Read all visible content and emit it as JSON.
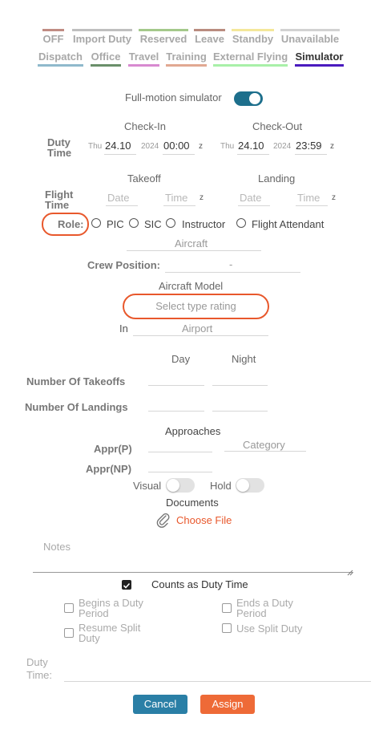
{
  "tabs_row1": [
    {
      "label": "OFF",
      "color": "#c08c83"
    },
    {
      "label": "Import Duty",
      "color": "#bfbfbf"
    },
    {
      "label": "Reserved",
      "color": "#a4c98b"
    },
    {
      "label": "Leave",
      "color": "#b98c7f"
    },
    {
      "label": "Standby",
      "color": "#f4e79a"
    },
    {
      "label": "Unavailable",
      "color": "#d2d2d2"
    }
  ],
  "tabs_row2": [
    {
      "label": "Dispatch",
      "color": "#8fb9cc"
    },
    {
      "label": "Office",
      "color": "#6a8f6a"
    },
    {
      "label": "Travel",
      "color": "#d88ad0"
    },
    {
      "label": "Training",
      "color": "#e1a892"
    },
    {
      "label": "External Flying",
      "color": "#a8f0a8"
    },
    {
      "label": "Simulator",
      "color": "#4a1bbf",
      "active": true
    }
  ],
  "simulator_toggle": {
    "label": "Full-motion simulator",
    "on": true,
    "color": "#1d6f8c"
  },
  "duty_time": {
    "label_line1": "Duty",
    "label_line2": "Time",
    "check_in": {
      "header": "Check-In",
      "day": "Thu",
      "date": "24.10",
      "year": "2024",
      "time": "00:00",
      "tz": "z"
    },
    "check_out": {
      "header": "Check-Out",
      "day": "Thu",
      "date": "24.10",
      "year": "2024",
      "time": "23:59",
      "tz": "z"
    }
  },
  "flight_time": {
    "label_line1": "Flight",
    "label_line2": "Time",
    "takeoff": {
      "header": "Takeoff",
      "date_placeholder": "Date",
      "time_placeholder": "Time",
      "tz": "z"
    },
    "landing": {
      "header": "Landing",
      "date_placeholder": "Date",
      "time_placeholder": "Time",
      "tz": "z"
    }
  },
  "role": {
    "label": "Role:",
    "options": [
      "PIC",
      "SIC",
      "Instructor",
      "Flight Attendant"
    ]
  },
  "aircraft": {
    "placeholder": "Aircraft"
  },
  "crew_position": {
    "label": "Crew Position:",
    "value": "-"
  },
  "aircraft_model": {
    "label": "Aircraft Model",
    "select_placeholder": "Select type rating"
  },
  "airport": {
    "label": "In",
    "placeholder": "Airport"
  },
  "counts": {
    "day_header": "Day",
    "night_header": "Night",
    "takeoffs_label": "Number Of Takeoffs",
    "landings_label": "Number Of Landings"
  },
  "approaches": {
    "header": "Approaches",
    "category_placeholder": "Category",
    "appr_p_label": "Appr(P)",
    "appr_np_label": "Appr(NP)",
    "visual_label": "Visual",
    "hold_label": "Hold"
  },
  "documents": {
    "header": "Documents",
    "choose_file_label": "Choose File"
  },
  "notes": {
    "placeholder": "Notes"
  },
  "duty_flags": {
    "counts_as_duty": "Counts as Duty Time",
    "begins_line1": "Begins a Duty",
    "begins_line2": "Period",
    "ends_line1": "Ends a Duty",
    "ends_line2": "Period",
    "resume_line1": "Resume Split",
    "resume_line2": "Duty",
    "use_split": "Use Split Duty"
  },
  "duty_time_field": {
    "label_line1": "Duty",
    "label_line2": "Time:"
  },
  "buttons": {
    "cancel": "Cancel",
    "assign": "Assign",
    "cancel_color": "#2a7fa6",
    "assign_color": "#ee6a37"
  },
  "highlight_color": "#e8582c"
}
